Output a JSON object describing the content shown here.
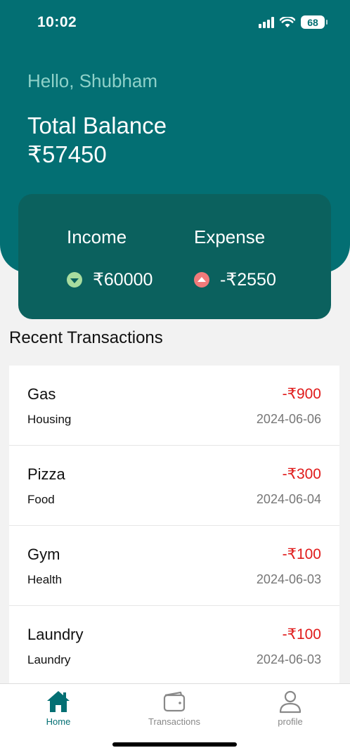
{
  "status_bar": {
    "time": "10:02",
    "battery": "68"
  },
  "header": {
    "greeting": "Hello, Shubham",
    "balance_title": "Total Balance",
    "balance_value": "₹57450"
  },
  "summary": {
    "income_label": "Income",
    "income_value": "₹60000",
    "expense_label": "Expense",
    "expense_value": "-₹2550"
  },
  "recent": {
    "title": "Recent Transactions",
    "items": [
      {
        "name": "Gas",
        "category": "Housing",
        "amount": "-₹900",
        "date": "2024-06-06"
      },
      {
        "name": "Pizza",
        "category": "Food",
        "amount": "-₹300",
        "date": "2024-06-04"
      },
      {
        "name": "Gym",
        "category": "Health",
        "amount": "-₹100",
        "date": "2024-06-03"
      },
      {
        "name": "Laundry",
        "category": "Laundry",
        "amount": "-₹100",
        "date": "2024-06-03"
      }
    ]
  },
  "tabs": [
    {
      "label": "Home",
      "icon": "home-icon",
      "active": true
    },
    {
      "label": "Transactions",
      "icon": "wallet-icon",
      "active": false
    },
    {
      "label": "profile",
      "icon": "person-icon",
      "active": false
    }
  ],
  "colors": {
    "header_bg": "#036f73",
    "card_bg": "#0b615e",
    "expense_red": "#e01b1b",
    "income_green": "#a8dc9f",
    "expense_badge": "#f07a7a"
  }
}
